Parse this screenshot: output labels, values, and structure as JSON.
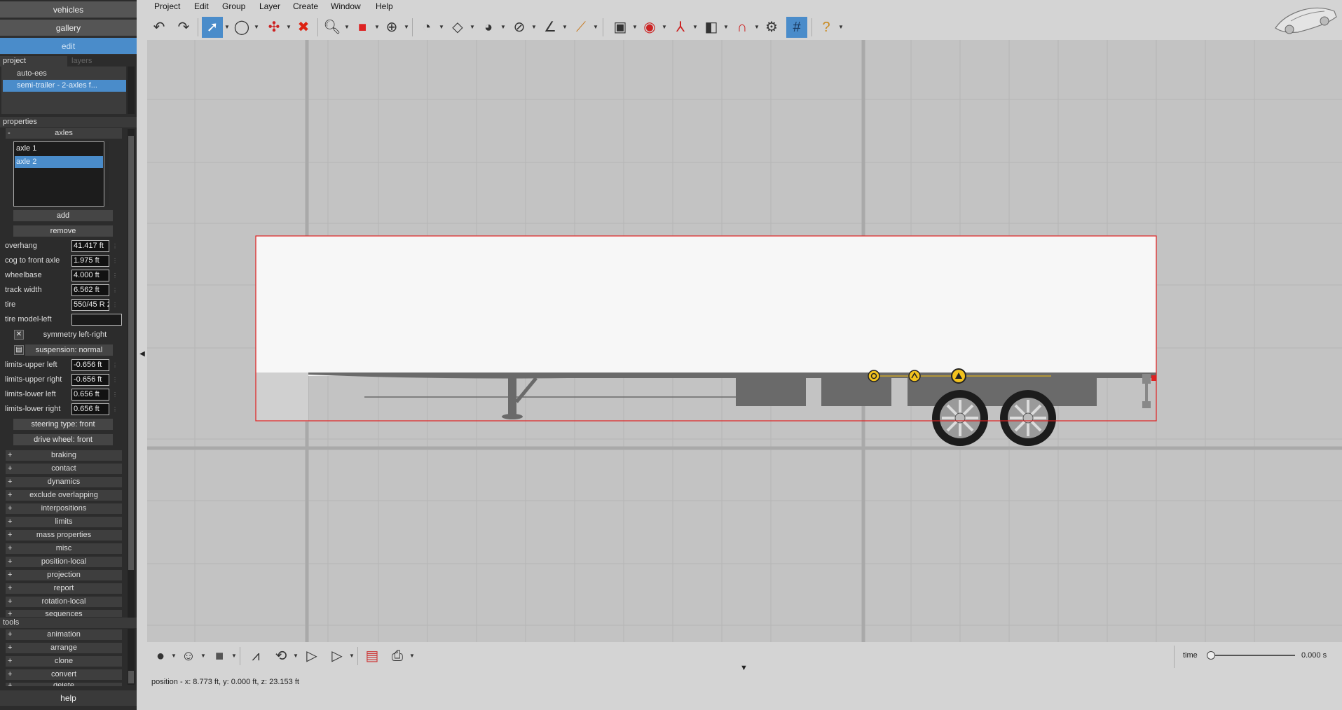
{
  "nav": {
    "vehicles": "vehicles",
    "gallery": "gallery",
    "edit": "edit"
  },
  "project": {
    "section": "project",
    "tab_project": "project",
    "tab_layers": "layers",
    "items": [
      "auto-ees",
      "semi-trailer - 2-axles f..."
    ]
  },
  "properties": {
    "section": "properties",
    "axles_group": "axles",
    "axle_list": [
      "axle 1",
      "axle 2"
    ],
    "add": "add",
    "remove": "remove",
    "fields": [
      {
        "label": "overhang",
        "value": "41.417 ft"
      },
      {
        "label": "cog to front axle",
        "value": "1.975 ft"
      },
      {
        "label": "wheelbase",
        "value": "4.000 ft"
      },
      {
        "label": "track width",
        "value": "6.562 ft"
      },
      {
        "label": "tire",
        "value": "550/45 R 2"
      },
      {
        "label": "tire model-left",
        "value": ""
      }
    ],
    "symmetry": "symmetry left-right",
    "suspension": "suspension: normal",
    "limits": [
      {
        "label": "limits-upper left",
        "value": "-0.656 ft"
      },
      {
        "label": "limits-upper right",
        "value": "-0.656 ft"
      },
      {
        "label": "limits-lower left",
        "value": "0.656 ft"
      },
      {
        "label": "limits-lower right",
        "value": "0.656 ft"
      }
    ],
    "steering_type": "steering type: front",
    "drive_wheel": "drive wheel: front",
    "groups": [
      "braking",
      "contact",
      "dynamics",
      "exclude overlapping",
      "interpositions",
      "limits",
      "mass properties",
      "misc",
      "position-local",
      "projection",
      "report",
      "rotation-local",
      "sequences"
    ]
  },
  "tools": {
    "section": "tools",
    "groups": [
      "animation",
      "arrange",
      "clone",
      "convert",
      "delete"
    ]
  },
  "help": "help",
  "menubar": [
    "Project",
    "Edit",
    "Group",
    "Layer",
    "Create",
    "Window",
    "Help"
  ],
  "time": {
    "label": "time",
    "value": "0.000 s",
    "progress": 0
  },
  "status": "position - x: 8.773 ft, y: 0.000 ft, z: 23.153 ft",
  "colors": {
    "accent": "#4a8cca",
    "panel": "#2c2c2c",
    "selection_outline": "#e02020",
    "viewport": "#c3c3c3"
  }
}
